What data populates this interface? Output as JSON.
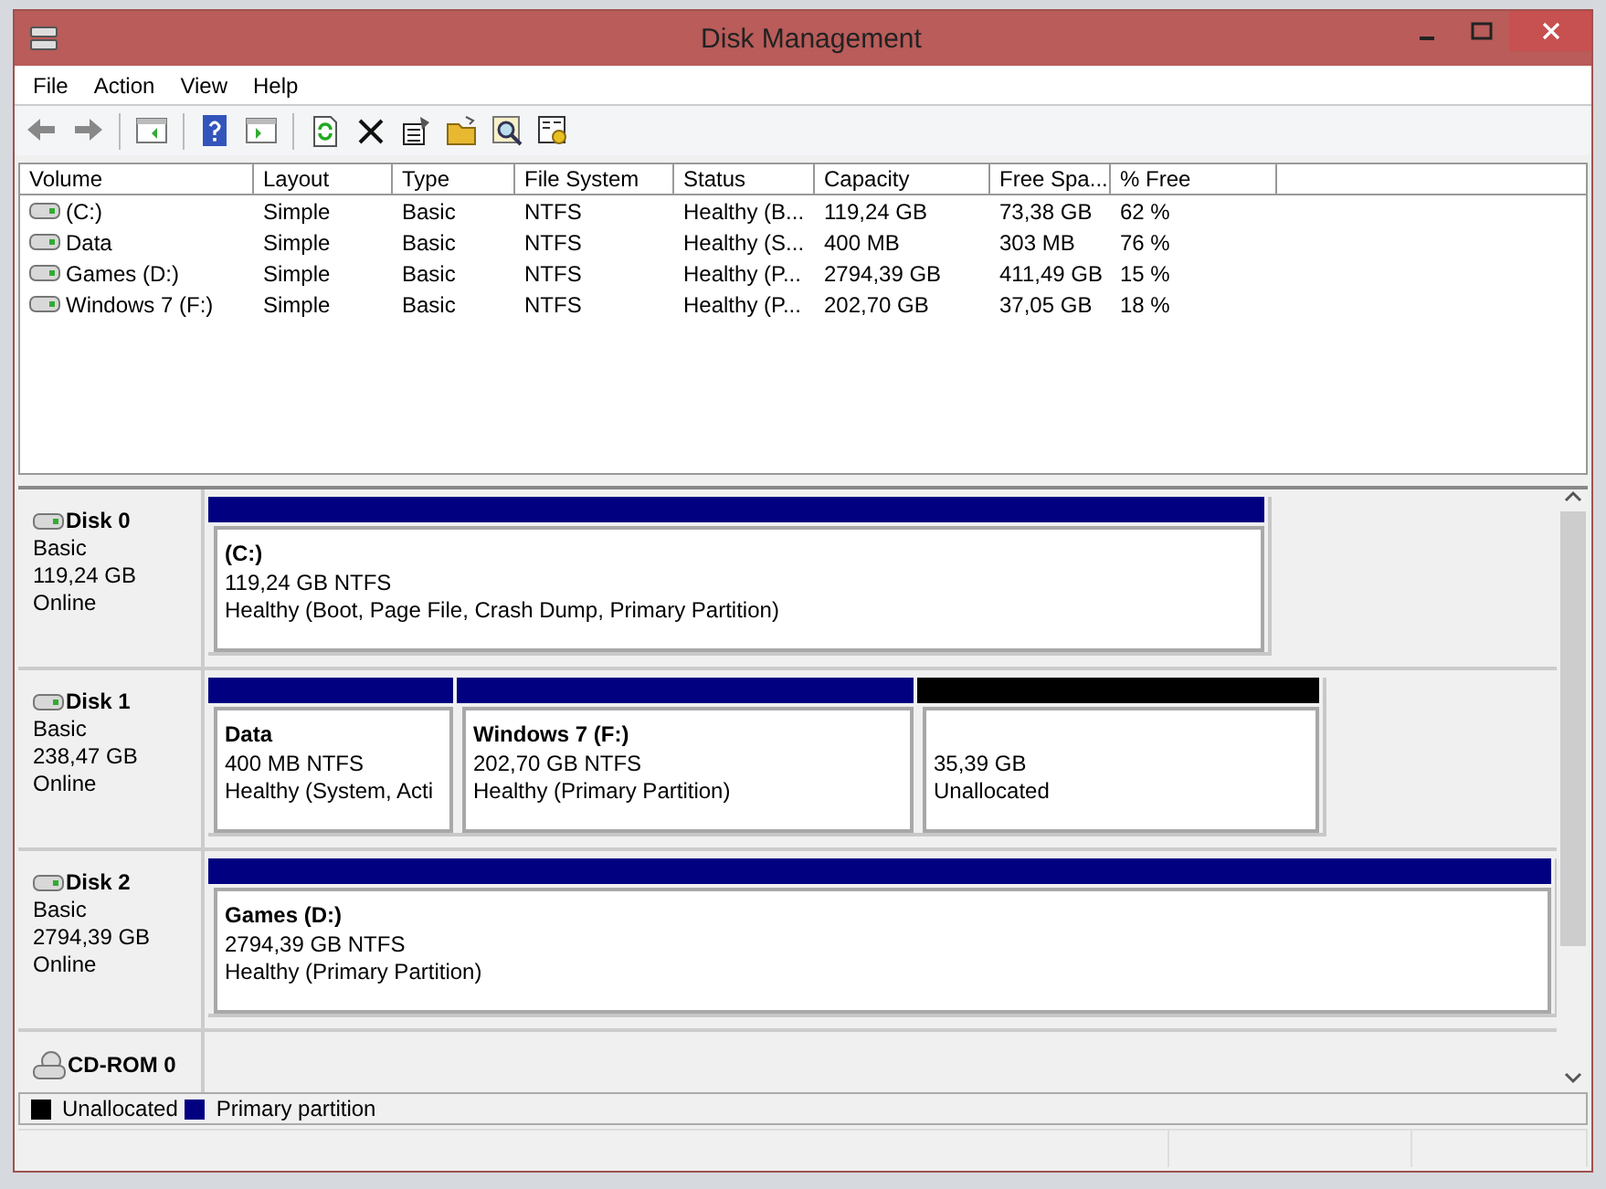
{
  "window": {
    "title": "Disk Management"
  },
  "menu": [
    "File",
    "Action",
    "View",
    "Help"
  ],
  "table": {
    "columns": [
      "Volume",
      "Layout",
      "Type",
      "File System",
      "Status",
      "Capacity",
      "Free Spa...",
      "% Free"
    ],
    "rows": [
      {
        "cells": [
          "(C:)",
          "Simple",
          "Basic",
          "NTFS",
          "Healthy (B...",
          "119,24 GB",
          "73,38 GB",
          "62 %"
        ]
      },
      {
        "cells": [
          "Data",
          "Simple",
          "Basic",
          "NTFS",
          "Healthy (S...",
          "400 MB",
          "303 MB",
          "76 %"
        ]
      },
      {
        "cells": [
          "Games (D:)",
          "Simple",
          "Basic",
          "NTFS",
          "Healthy (P...",
          "2794,39 GB",
          "411,49 GB",
          "15 %"
        ]
      },
      {
        "cells": [
          "Windows 7 (F:)",
          "Simple",
          "Basic",
          "NTFS",
          "Healthy (P...",
          "202,70 GB",
          "37,05 GB",
          "18 %"
        ]
      }
    ]
  },
  "disks": [
    {
      "kind": "disk",
      "name": "Disk 0",
      "info": [
        "Basic",
        "119,24 GB",
        "Online"
      ],
      "partitions": [
        {
          "kind": "primary",
          "name": "(C:)",
          "lines": [
            "119,24 GB NTFS",
            "Healthy (Boot, Page File, Crash Dump, Primary Partition)"
          ]
        }
      ]
    },
    {
      "kind": "disk",
      "name": "Disk 1",
      "info": [
        "Basic",
        "238,47 GB",
        "Online"
      ],
      "partitions": [
        {
          "kind": "primary",
          "name": "Data",
          "lines": [
            "400 MB NTFS",
            "Healthy (System, Acti"
          ]
        },
        {
          "kind": "primary",
          "name": "Windows 7  (F:)",
          "lines": [
            "202,70 GB NTFS",
            "Healthy (Primary Partition)"
          ]
        },
        {
          "kind": "unallocated",
          "lines": [
            "35,39 GB",
            "Unallocated"
          ]
        }
      ]
    },
    {
      "kind": "disk",
      "name": "Disk 2",
      "info": [
        "Basic",
        "2794,39 GB",
        "Online"
      ],
      "partitions": [
        {
          "kind": "primary",
          "name": "Games  (D:)",
          "lines": [
            "2794,39 GB NTFS",
            "Healthy (Primary Partition)"
          ]
        }
      ]
    },
    {
      "kind": "cdrom",
      "name": "CD-ROM 0"
    }
  ],
  "legend": [
    {
      "kind": "unallocated",
      "label": "Unallocated"
    },
    {
      "kind": "primary",
      "label": "Primary partition"
    }
  ]
}
